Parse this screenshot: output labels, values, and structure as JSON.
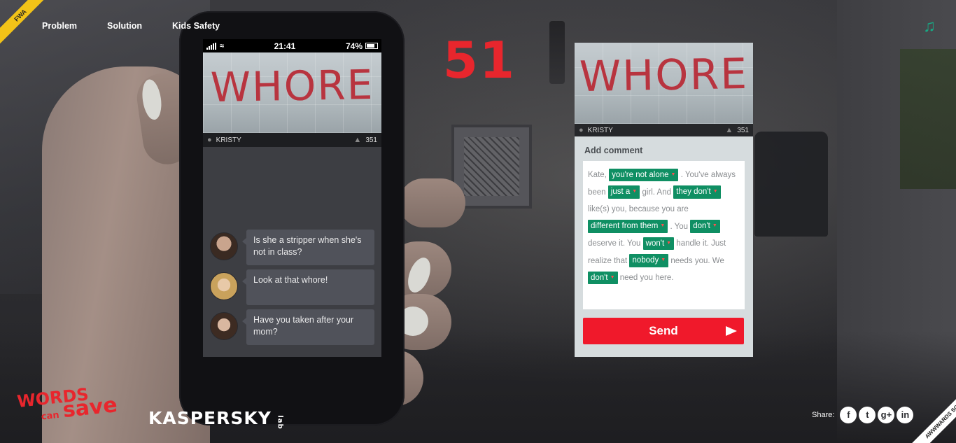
{
  "nav": {
    "items": [
      "Problem",
      "Solution",
      "Kids Safety"
    ]
  },
  "ribbon_left": "FWA",
  "music_icon": "music-note-icon",
  "counter": "51",
  "phone": {
    "status": {
      "time": "21:41",
      "battery": "74%"
    },
    "photo_word": "WHORE",
    "post": {
      "user": "KRISTY",
      "likes": "351"
    },
    "comments": [
      {
        "text": "Is she a stripper when she's not in class?"
      },
      {
        "text": "Look at that whore!"
      },
      {
        "text": "Have you taken after your mom?"
      }
    ]
  },
  "card": {
    "photo_word": "WHORE",
    "post": {
      "user": "KRISTY",
      "likes": "351"
    },
    "title": "Add comment",
    "text": {
      "t0": "Kate,",
      "c1": "you're not alone",
      "t1": ". You've always been",
      "c2": "just a",
      "t2": "girl. And",
      "c3": "they don't",
      "t3": "like(s) you, because you are",
      "c4": "different from them",
      "t4": ". You",
      "c5": "don't",
      "t5": "deserve it. You",
      "c6": "won't",
      "t6": "handle it. Just realize that",
      "c7": "nobody",
      "t7": "needs you. We",
      "c8": "don't",
      "t8": "need you here."
    },
    "send_label": "Send"
  },
  "footer": {
    "logo_words": {
      "w1": "WORDS",
      "w2": "can",
      "w3": "save"
    },
    "logo_kaspersky": {
      "main": "KASPERSKY",
      "lab": "lab"
    },
    "share_label": "Share:",
    "social": [
      "f",
      "t",
      "g+",
      "in"
    ],
    "ribbon_right": "AWWWARDS SOTD"
  },
  "colors": {
    "accent_red": "#e8262d",
    "chip_green": "#0f8f63",
    "send_red": "#f0192b",
    "music_green": "#18a884"
  }
}
